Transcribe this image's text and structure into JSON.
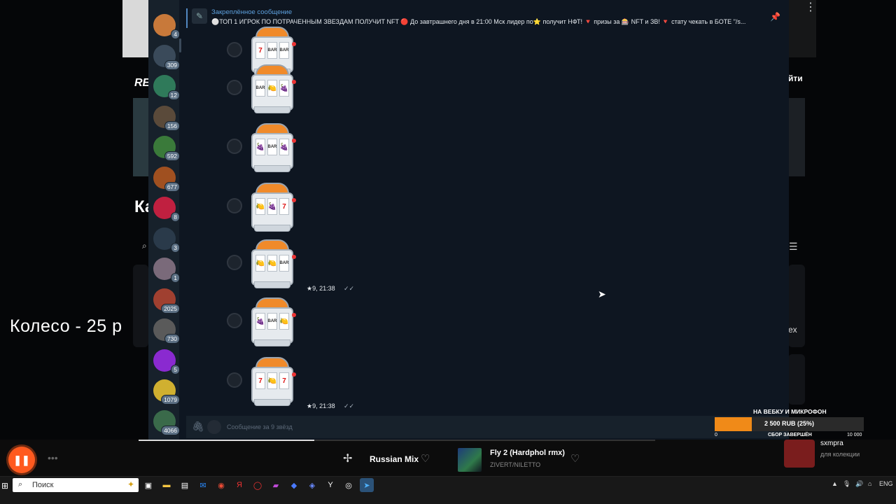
{
  "background": {
    "wheel_text": "Колесо - 25 р",
    "label_re": "RE",
    "label_k": "Ка",
    "label_yti": "йти",
    "label_ex": "ex"
  },
  "telegram": {
    "sidebar": [
      {
        "name": "chat-1",
        "badge": "4",
        "color": "#c8793a"
      },
      {
        "name": "chat-2",
        "badge": "309",
        "color": "#3a4a5a"
      },
      {
        "name": "chat-3",
        "badge": "12",
        "color": "#2f7a5a"
      },
      {
        "name": "chat-4",
        "badge": "156",
        "color": "#5a4a3a"
      },
      {
        "name": "chat-5",
        "badge": "592",
        "color": "#3a7a3a"
      },
      {
        "name": "chat-6",
        "badge": "677",
        "color": "#a05020"
      },
      {
        "name": "chat-7",
        "badge": "8",
        "color": "#c02040"
      },
      {
        "name": "chat-8",
        "badge": "3",
        "color": "#2a3a4a"
      },
      {
        "name": "chat-9",
        "badge": "1",
        "color": "#7a6a7a"
      },
      {
        "name": "chat-10",
        "badge": "2025",
        "color": "#a04030"
      },
      {
        "name": "chat-11",
        "badge": "730",
        "color": "#5a5a5a"
      },
      {
        "name": "chat-12",
        "badge": "5",
        "color": "#8a2ad0"
      },
      {
        "name": "chat-13",
        "badge": "1079",
        "color": "#d0b030"
      },
      {
        "name": "chat-14",
        "badge": "4066",
        "color": "#3a6a4a"
      }
    ],
    "pinned": {
      "title": "Закреплённое сообщение",
      "text": "⚪ТОП 1 ИГРОК ПО ПОТРАЧЕННЫМ ЗВЕЗДАМ ПОЛУЧИТ NFT 🔴 До завтрашнего дня в 21:00 Мск лидер по⭐ получит НФТ! 🔻 призы за 🎰 NFT и ЗВ! 🔻 стату чекать в БОТЕ \"/s..."
    },
    "messages": [
      {
        "reels": [
          "7",
          "BAR",
          "BAR"
        ],
        "time": ""
      },
      {
        "reels": [
          "BAR",
          "🍋",
          "🍇"
        ],
        "time": ""
      },
      {
        "reels": [
          "🍇",
          "BAR",
          "🍇"
        ],
        "time": ""
      },
      {
        "reels": [
          "🍋",
          "🍇",
          "7"
        ],
        "time": ""
      },
      {
        "reels": [
          "🍋",
          "🍋",
          "BAR"
        ],
        "time": "★9, 21:38"
      },
      {
        "reels": [
          "🍇",
          "BAR",
          "🍋"
        ],
        "time": ""
      },
      {
        "reels": [
          "7",
          "🍋",
          "7"
        ],
        "time": "★9, 21:38"
      }
    ],
    "compose_placeholder": "Сообщение за 9 звёзд"
  },
  "donation": {
    "title": "НА ВЕБКУ И МИКРОФОН",
    "label": "2 500 RUB (25%)",
    "progress": 0.25,
    "min": "0",
    "max": "10 000",
    "status": "СБОР ЗАВЕРШЁН"
  },
  "player": {
    "playlist": "Russian Mix",
    "track_title": "Fly 2 (Hardphol rmx)",
    "track_artist": "ZIVERT/NILETTO",
    "progress": 0.34,
    "cam_name": "sxmpra",
    "cam_sub": "для колекции"
  },
  "taskbar": {
    "search_placeholder": "Поиск",
    "lang": "ENG"
  }
}
